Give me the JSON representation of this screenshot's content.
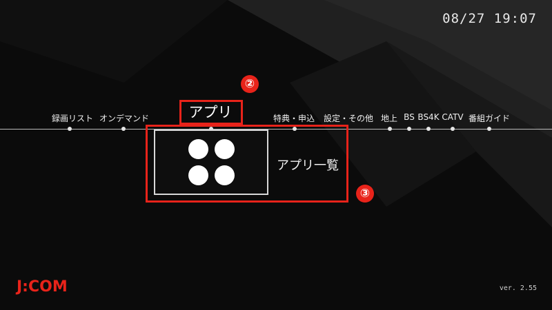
{
  "header": {
    "clock": "08/27 19:07"
  },
  "nav": {
    "items": [
      {
        "label": "録画リスト"
      },
      {
        "label": "オンデマンド"
      },
      {
        "label": "アプリ"
      },
      {
        "label": "特典・申込"
      },
      {
        "label": "設定・その他"
      },
      {
        "label": "地上"
      },
      {
        "label": "BS"
      },
      {
        "label": "BS4K"
      },
      {
        "label": "CATV"
      },
      {
        "label": "番組ガイド"
      }
    ],
    "active_label": "アプリ"
  },
  "content": {
    "tile_label": "アプリ一覧",
    "tile_icon": "four-dots-icon"
  },
  "annotations": {
    "badge_2": "②",
    "badge_3": "③"
  },
  "footer": {
    "logo": "J:COM",
    "version": "ver. 2.55"
  },
  "colors": {
    "accent": "#e8231a",
    "background": "#0b0b0b"
  }
}
